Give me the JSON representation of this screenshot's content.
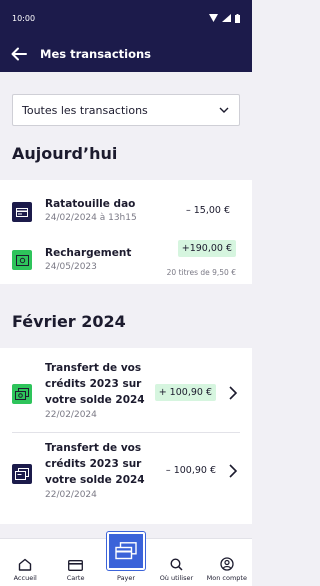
{
  "status_bar": {
    "time": "10:00"
  },
  "header": {
    "title": "Mes transactions",
    "back_icon": "arrow-left-icon"
  },
  "filter": {
    "selected": "Toutes les transactions"
  },
  "sections": [
    {
      "title": "Aujourd’hui",
      "transactions": [
        {
          "name": "Ratatouille dao",
          "date": "24/02/2024 à 13h15",
          "amount": "– 15,00 €",
          "icon": "card-icon"
        },
        {
          "name": "Rechargement",
          "date": "24/05/2023",
          "amount": "+190,00 €",
          "sub": "20 titres de 9,50 €",
          "icon": "recharge-icon"
        }
      ]
    },
    {
      "title": "Février 2024",
      "transactions": [
        {
          "name_lines": [
            "Transfert de vos",
            "crédits 2023 sur",
            "votre solde 2024"
          ],
          "date": "22/02/2024",
          "amount": "+ 100,90 €",
          "icon": "transfer-in-icon"
        },
        {
          "name_lines": [
            "Transfert de vos",
            "crédits 2023 sur",
            "votre solde 2024"
          ],
          "date": "22/02/2024",
          "amount": "– 100,90 €",
          "icon": "transfer-out-icon"
        }
      ]
    }
  ],
  "nav": {
    "items": [
      {
        "label": "Accueil",
        "icon": "home-icon"
      },
      {
        "label": "Carte",
        "icon": "card-icon"
      },
      {
        "label": "Payer",
        "icon": "pay-icon"
      },
      {
        "label": "Où utiliser",
        "icon": "search-icon"
      },
      {
        "label": "Mon compte",
        "icon": "account-icon"
      }
    ]
  },
  "colors": {
    "header_bg": "#1c1b4b",
    "accent_green": "#2ec45b",
    "credit_pill": "#d6f5df",
    "pay_blue": "#3b63d9"
  }
}
